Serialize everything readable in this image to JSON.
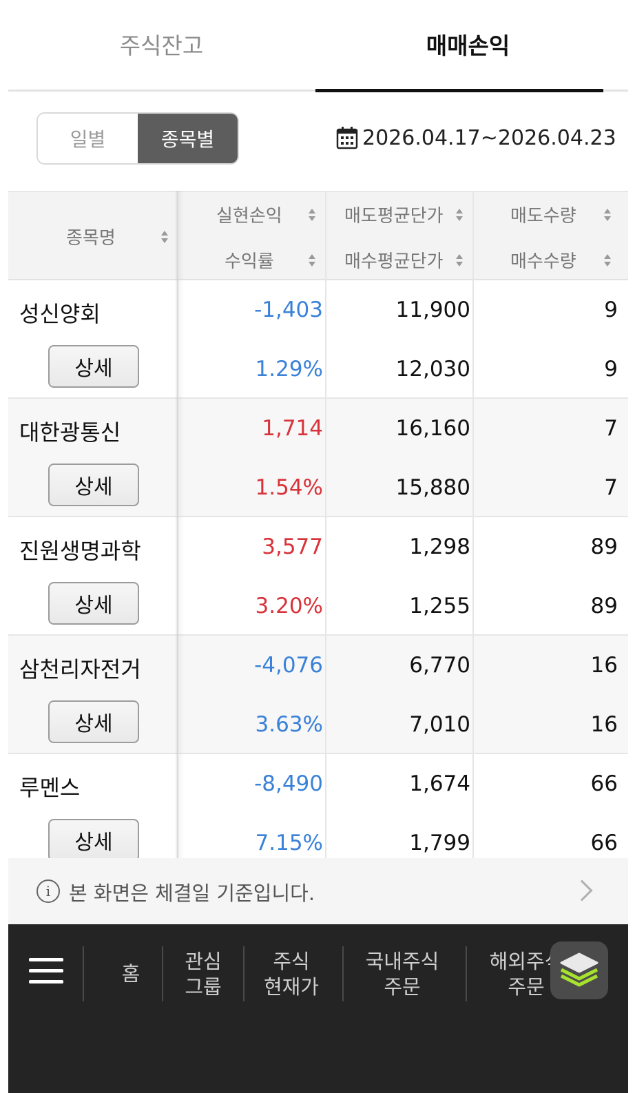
{
  "tabs": {
    "holdings": "주식잔고",
    "trading_pl": "매매손익"
  },
  "toggle": {
    "daily": "일별",
    "by_stock": "종목별"
  },
  "date_range": "2026.04.17~2026.04.23",
  "headers": {
    "stock_name": "종목명",
    "realized_pl": "실현손익",
    "return_rate": "수익률",
    "avg_sell_price": "매도평균단가",
    "avg_buy_price": "매수평균단가",
    "sell_qty": "매도수량",
    "buy_qty": "매수수량"
  },
  "detail_label": "상세",
  "rows": [
    {
      "name": "성신양회",
      "pl": "-1,403",
      "rate": "1.29%",
      "sell_price": "11,900",
      "buy_price": "12,030",
      "sell_qty": "9",
      "buy_qty": "9",
      "tone": "neg"
    },
    {
      "name": "대한광통신",
      "pl": "1,714",
      "rate": "1.54%",
      "sell_price": "16,160",
      "buy_price": "15,880",
      "sell_qty": "7",
      "buy_qty": "7",
      "tone": "pos"
    },
    {
      "name": "진원생명과학",
      "pl": "3,577",
      "rate": "3.20%",
      "sell_price": "1,298",
      "buy_price": "1,255",
      "sell_qty": "89",
      "buy_qty": "89",
      "tone": "pos"
    },
    {
      "name": "삼천리자전거",
      "pl": "-4,076",
      "rate": "3.63%",
      "sell_price": "6,770",
      "buy_price": "7,010",
      "sell_qty": "16",
      "buy_qty": "16",
      "tone": "neg"
    },
    {
      "name": "루멘스",
      "pl": "-8,490",
      "rate": "7.15%",
      "sell_price": "1,674",
      "buy_price": "1,799",
      "sell_qty": "66",
      "buy_qty": "66",
      "tone": "neg"
    }
  ],
  "info_text": "본 화면은 체결일 기준입니다.",
  "bottom_nav": {
    "home": "홈",
    "watch_1": "관심",
    "watch_2": "그룹",
    "quote_1": "주식",
    "quote_2": "현재가",
    "dom_1": "국내주식",
    "dom_2": "주문",
    "intl_1": "해외주식",
    "intl_2": "주문"
  },
  "colors": {
    "negative": "#3a82d8",
    "positive": "#d8333a",
    "fab_accent": "#a6e22e"
  }
}
